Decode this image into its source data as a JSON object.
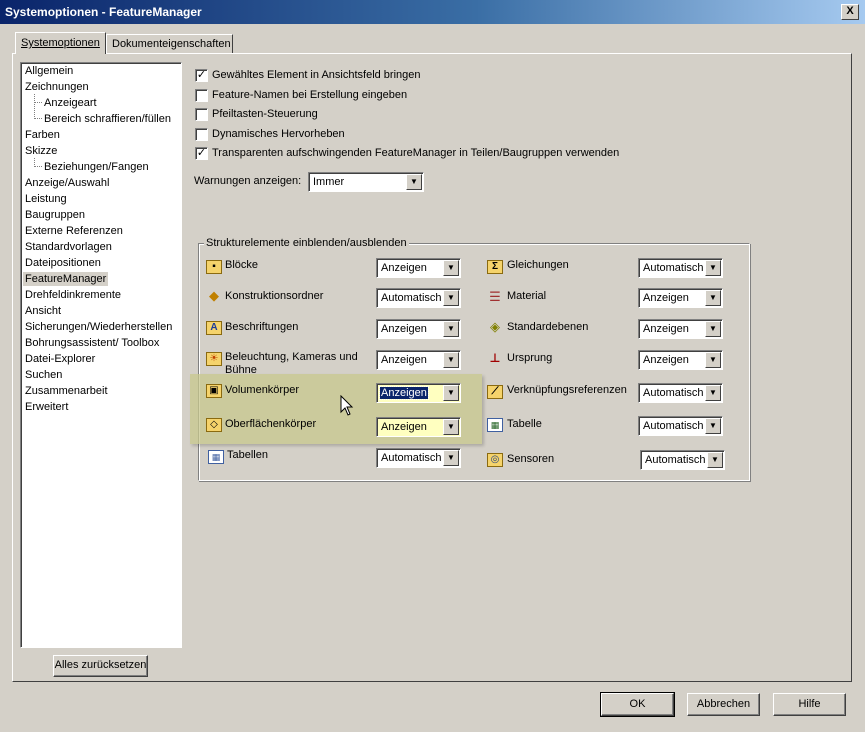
{
  "window": {
    "title": "Systemoptionen - FeatureManager",
    "close_label": "X"
  },
  "tabs": [
    {
      "label": "Systemoptionen"
    },
    {
      "label": "Dokumenteigenschaften"
    }
  ],
  "tree": [
    {
      "label": "Allgemein"
    },
    {
      "label": "Zeichnungen"
    },
    {
      "label": "Anzeigeart"
    },
    {
      "label": "Bereich schraffieren/füllen"
    },
    {
      "label": "Farben"
    },
    {
      "label": "Skizze"
    },
    {
      "label": "Beziehungen/Fangen"
    },
    {
      "label": "Anzeige/Auswahl"
    },
    {
      "label": "Leistung"
    },
    {
      "label": "Baugruppen"
    },
    {
      "label": "Externe Referenzen"
    },
    {
      "label": "Standardvorlagen"
    },
    {
      "label": "Dateipositionen"
    },
    {
      "label": "FeatureManager"
    },
    {
      "label": "Drehfeldinkremente"
    },
    {
      "label": "Ansicht"
    },
    {
      "label": "Sicherungen/Wiederherstellen"
    },
    {
      "label": "Bohrungsassistent/ Toolbox"
    },
    {
      "label": "Datei-Explorer"
    },
    {
      "label": "Suchen"
    },
    {
      "label": "Zusammenarbeit"
    },
    {
      "label": "Erweitert"
    }
  ],
  "reset_button": "Alles zurücksetzen",
  "options": [
    {
      "label": "Gewähltes Element in Ansichtsfeld bringen",
      "checked": true
    },
    {
      "label": "Feature-Namen bei Erstellung eingeben",
      "checked": false
    },
    {
      "label": "Pfeiltasten-Steuerung",
      "checked": false
    },
    {
      "label": "Dynamisches Hervorheben",
      "checked": false
    },
    {
      "label": "Transparenten aufschwingenden FeatureManager in Teilen/Baugruppen verwenden",
      "checked": true
    }
  ],
  "warnings": {
    "label": "Warnungen anzeigen:",
    "value": "Immer"
  },
  "group": {
    "title": "Strukturelemente einblenden/ausblenden",
    "left": [
      {
        "label": "Blöcke",
        "value": "Anzeigen",
        "icon": "blocks-folder-icon"
      },
      {
        "label": "Konstruktionsordner",
        "value": "Automatisch",
        "icon": "design-folder-icon"
      },
      {
        "label": "Beschriftungen",
        "value": "Anzeigen",
        "icon": "annotations-icon"
      },
      {
        "label": "Beleuchtung, Kameras und Bühne",
        "value": "Anzeigen",
        "icon": "lighting-icon"
      },
      {
        "label": "Volumenkörper",
        "value": "Anzeigen",
        "icon": "solid-bodies-icon"
      },
      {
        "label": "Oberflächenkörper",
        "value": "Anzeigen",
        "icon": "surface-bodies-icon"
      },
      {
        "label": "Tabellen",
        "value": "Automatisch",
        "icon": "tables-icon"
      }
    ],
    "right": [
      {
        "label": "Gleichungen",
        "value": "Automatisch",
        "icon": "equations-icon"
      },
      {
        "label": "Material",
        "value": "Anzeigen",
        "icon": "material-icon"
      },
      {
        "label": "Standardebenen",
        "value": "Anzeigen",
        "icon": "planes-icon"
      },
      {
        "label": "Ursprung",
        "value": "Anzeigen",
        "icon": "origin-icon"
      },
      {
        "label": "Verknüpfungsreferenzen",
        "value": "Automatisch",
        "icon": "mate-references-icon"
      },
      {
        "label": "Tabelle",
        "value": "Automatisch",
        "icon": "table-icon"
      },
      {
        "label": "Sensoren",
        "value": "Automatisch",
        "icon": "sensors-icon"
      }
    ]
  },
  "buttons": {
    "ok": "OK",
    "cancel": "Abbrechen",
    "help": "Hilfe"
  },
  "colors": {
    "titlebar": "#0a246a",
    "highlight": "#c9c88e",
    "background": "#d4d0c8"
  }
}
